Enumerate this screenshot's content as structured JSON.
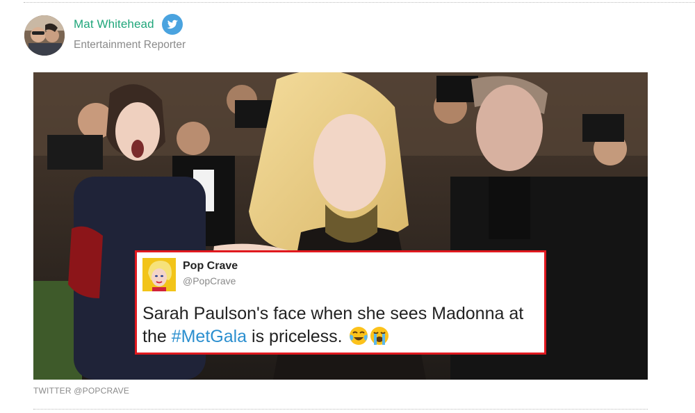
{
  "author": {
    "name": "Mat Whitehead",
    "role": "Entertainment Reporter",
    "avatar_icon": "author-avatar",
    "verified_icon": "twitter-bird-icon",
    "name_color": "#1fa67a"
  },
  "photo": {
    "caption": "TWITTER @POPCRAVE"
  },
  "tweet": {
    "display_name": "Pop Crave",
    "handle": "@PopCrave",
    "text_before": "Sarah Paulson's face when she sees Madonna at the ",
    "hashtag": "#MetGala",
    "text_after": " is priceless.",
    "emojis": [
      "face-with-tears-of-joy",
      "loudly-crying-face"
    ],
    "border_color": "#e0191f",
    "hashtag_color": "#2b8fcf"
  }
}
